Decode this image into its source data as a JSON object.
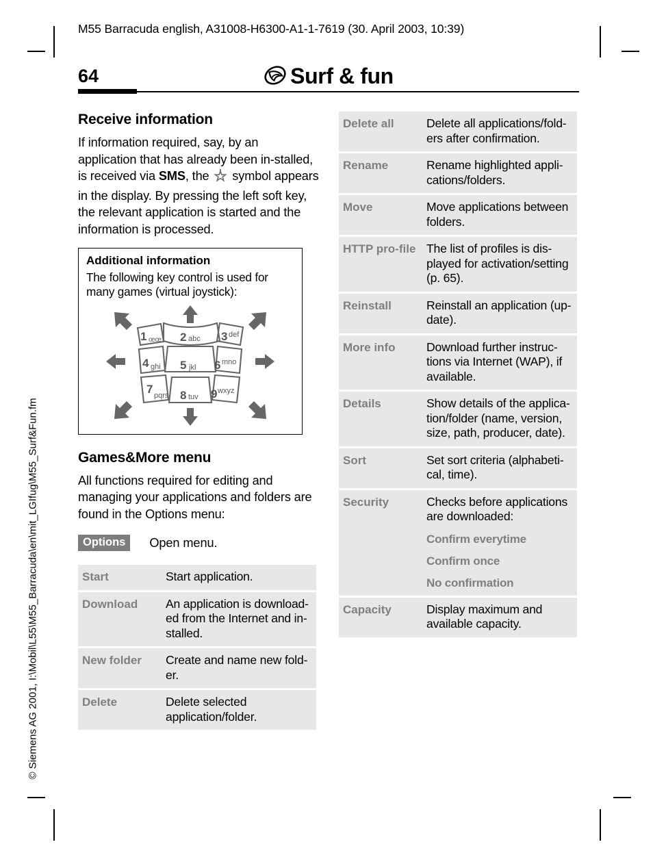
{
  "header": {
    "running_header": "M55 Barracuda english, A31008-H6300-A1-1-7619 (30. April 2003, 10:39)",
    "page_number": "64",
    "chapter_title": "Surf & fun",
    "chapter_icon": "globe-orbit-icon"
  },
  "side_note": "© Siemens AG 2001, I:\\Mobil\\L55\\M55_Barracuda\\en\\mit_LGIfug\\M55_Surf&Fun.fm",
  "left_column": {
    "receive_heading": "Receive information",
    "receive_text_part1": "If information required, say, by an application that has already been in-stalled, is received via ",
    "receive_text_bold": "SMS",
    "receive_text_part2": ", the ",
    "receive_symbol_name": "star-download-icon",
    "receive_text_part3": " symbol appears in the display. By pressing the left soft key, the relevant application is started and the information is processed.",
    "additional_info": {
      "title": "Additional information",
      "text": "The following key control is used for many games (virtual joystick):",
      "figure_name": "virtual-joystick-keypad-figure",
      "keys": [
        {
          "digit": "1",
          "letters": "œœ"
        },
        {
          "digit": "2",
          "letters": "abc"
        },
        {
          "digit": "3",
          "letters": "def"
        },
        {
          "digit": "4",
          "letters": "ghi"
        },
        {
          "digit": "5",
          "letters": "jkl"
        },
        {
          "digit": "6",
          "letters": "mno"
        },
        {
          "digit": "7",
          "letters": "pqrs"
        },
        {
          "digit": "8",
          "letters": "tuv"
        },
        {
          "digit": "9",
          "letters": "wxyz"
        }
      ],
      "arrows": [
        "up-left",
        "up",
        "up-right",
        "left",
        "right",
        "down-left",
        "down",
        "down-right"
      ]
    },
    "games_heading": "Games&More menu",
    "games_text": "All functions required for editing and managing your applications and folders are found in the Options menu:",
    "options_key_label": "Options",
    "options_key_desc": "Open menu.",
    "menu_rows": [
      {
        "label": "Start",
        "desc": "Start application."
      },
      {
        "label": "Download",
        "desc": "An application is download-ed from the Internet and in-stalled."
      },
      {
        "label": "New folder",
        "desc": "Create and name new fold-er."
      },
      {
        "label": "Delete",
        "desc": "Delete selected application/folder."
      }
    ]
  },
  "right_column": {
    "menu_rows": [
      {
        "label": "Delete all",
        "desc": "Delete all applications/fold-ers after confirmation."
      },
      {
        "label": "Rename",
        "desc": "Rename highlighted appli-cations/folders."
      },
      {
        "label": "Move",
        "desc": "Move applications between folders."
      },
      {
        "label": "HTTP pro-file",
        "desc": "The list of profiles is dis-played for activation/setting (p. 65)."
      },
      {
        "label": "Reinstall",
        "desc": "Reinstall an application (up-date)."
      },
      {
        "label": "More info",
        "desc": "Download further instruc-tions via Internet (WAP), if available."
      },
      {
        "label": "Details",
        "desc": "Show details of the applica-tion/folder (name, version, size, path, producer, date)."
      },
      {
        "label": "Sort",
        "desc": "Set sort criteria (alphabeti-cal, time)."
      },
      {
        "label": "Security",
        "desc": "Checks before applications are downloaded:",
        "sub_options": [
          "Confirm everytime",
          "Confirm once",
          "No confirmation"
        ]
      },
      {
        "label": "Capacity",
        "desc": "Display maximum and available capacity."
      }
    ]
  },
  "colors": {
    "table_row_bg": "#e7e7e7",
    "label_gray": "#7f7f7f",
    "softkey_bg": "#7d7d7d",
    "figure_gray": "#666666",
    "text_black": "#000000"
  }
}
